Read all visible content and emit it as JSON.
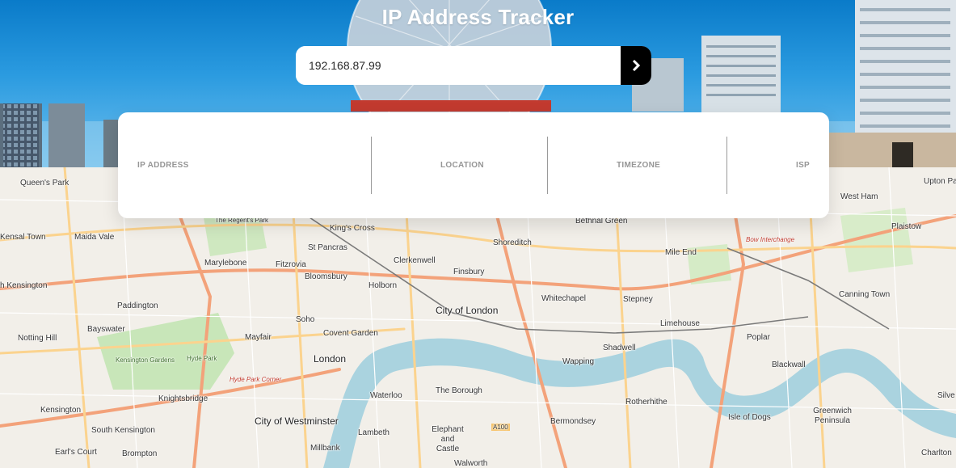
{
  "header": {
    "title": "IP Address Tracker"
  },
  "search": {
    "value": "192.168.87.99",
    "button_icon": "chevron-right-icon"
  },
  "info": {
    "ip_label": "IP ADDRESS",
    "location_label": "LOCATION",
    "timezone_label": "TIMEZONE",
    "isp_label": "ISP"
  },
  "map": {
    "places": {
      "queens_park": "Queen's Park",
      "maida_vale": "Maida Vale",
      "kensal_town": "Kensal Town",
      "the_regents_park": "The Regent's Park",
      "kings_cross": "King's Cross",
      "st_pancras": "St Pancras",
      "bethnal_green": "Bethnal Green",
      "shoreditch": "Shoreditch",
      "mile_end": "Mile End",
      "bow_interchange": "Bow Interchange",
      "west_ham": "West Ham",
      "plaistow": "Plaistow",
      "upton_park": "Upton Par",
      "marylebone": "Marylebone",
      "fitzrovia": "Fitzrovia",
      "clerkenwell": "Clerkenwell",
      "finsbury": "Finsbury",
      "bloomsbury": "Bloomsbury",
      "holborn": "Holborn",
      "north_kensington": "h Kensington",
      "paddington": "Paddington",
      "whitechapel": "Whitechapel",
      "stepney": "Stepney",
      "city_of_london": "City of London",
      "canning_town": "Canning Town",
      "notting_hill": "Notting Hill",
      "bayswater": "Bayswater",
      "soho": "Soho",
      "mayfair": "Mayfair",
      "covent_garden": "Covent Garden",
      "limehouse": "Limehouse",
      "poplar": "Poplar",
      "kensington_gardens": "Kensington Gardens",
      "hyde_park": "Hyde Park",
      "london": "London",
      "shadwell": "Shadwell",
      "wapping": "Wapping",
      "blackwall": "Blackwall",
      "hyde_park_corner": "Hyde Park Corner",
      "waterloo": "Waterloo",
      "the_borough": "The Borough",
      "knightsbridge": "Knightsbridge",
      "rotherhithe": "Rotherhithe",
      "silvertown": "Silve",
      "kensington": "Kensington",
      "city_of_westminster": "City of Westminster",
      "bermondsey": "Bermondsey",
      "isle_of_dogs": "Isle of Dogs",
      "greenwich_peninsula": "Greenwich Peninsula",
      "lambeth": "Lambeth",
      "elephant_castle": "Elephant and Castle",
      "south_kensington": "South Kensington",
      "earls_court": "Earl's Court",
      "brompton": "Brompton",
      "millbank": "Millbank",
      "walworth": "Walworth",
      "charlton": "Charlton",
      "a100": "A100"
    }
  }
}
